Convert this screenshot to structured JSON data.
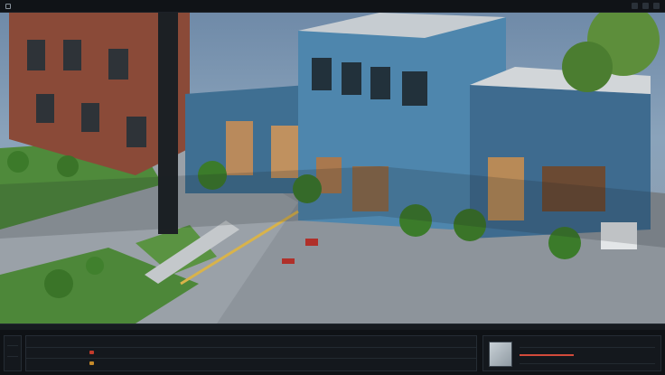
{
  "app": {
    "title": "",
    "menu_item": ""
  },
  "viewport": {
    "scene": "isometric-street-render"
  },
  "colors": {
    "accent": "#d24a3a",
    "building_blue": "#4e86ad",
    "brick": "#8a4a38"
  },
  "timeline": {
    "label_a": "",
    "label_b": "",
    "label_c": ""
  }
}
